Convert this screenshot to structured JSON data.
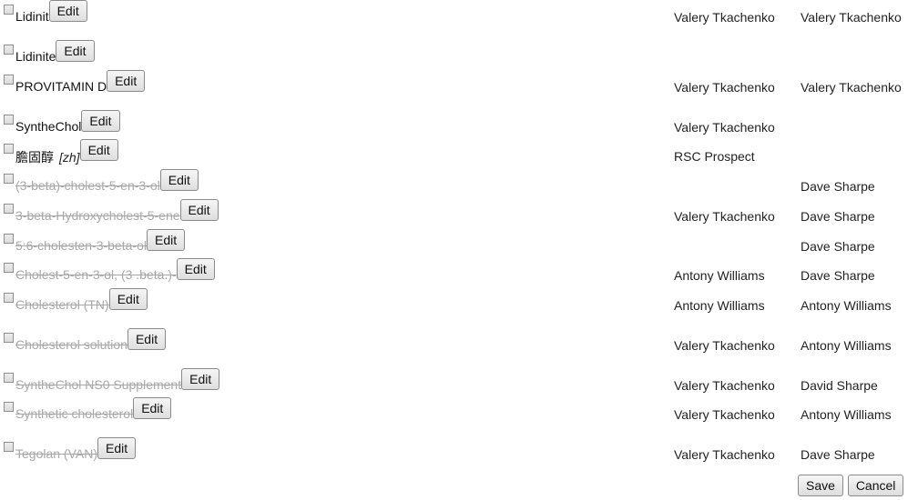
{
  "rows": [
    {
      "name": "Lidinit",
      "deleted": false,
      "lang": "",
      "curator": "Valery Tkachenko",
      "approver": "Valery Tkachenko",
      "edit_label": "Edit"
    },
    {
      "name": "Lidinite",
      "deleted": false,
      "lang": "",
      "curator": "",
      "approver": "",
      "edit_label": "Edit"
    },
    {
      "name": "PROVITAMIN D",
      "deleted": false,
      "lang": "",
      "curator": "Valery Tkachenko",
      "approver": "Valery Tkachenko",
      "edit_label": "Edit"
    },
    {
      "name": "SyntheChol",
      "deleted": false,
      "lang": "",
      "curator": "Valery Tkachenko",
      "approver": "",
      "edit_label": "Edit"
    },
    {
      "name": "膽固醇",
      "deleted": false,
      "lang": "[zh]",
      "curator": "RSC Prospect",
      "approver": "",
      "edit_label": "Edit"
    },
    {
      "name": "(3-beta)-cholest-5-en-3-ol",
      "deleted": true,
      "lang": "",
      "curator": "",
      "approver": "Dave Sharpe",
      "edit_label": "Edit"
    },
    {
      "name": "3-beta-Hydroxycholest-5-ene",
      "deleted": true,
      "lang": "",
      "curator": "Valery Tkachenko",
      "approver": "Dave Sharpe",
      "edit_label": "Edit"
    },
    {
      "name": "5:6-cholesten-3-beta-ol",
      "deleted": true,
      "lang": "",
      "curator": "",
      "approver": "Dave Sharpe",
      "edit_label": "Edit"
    },
    {
      "name": "Cholest-5-en-3-ol, (3 .beta.)-",
      "deleted": true,
      "lang": "",
      "curator": "Antony Williams",
      "approver": "Dave Sharpe",
      "edit_label": "Edit"
    },
    {
      "name": "Cholesterol (TN)",
      "deleted": true,
      "lang": "",
      "curator": "Antony Williams",
      "approver": "Antony Williams",
      "edit_label": "Edit"
    },
    {
      "name": "Cholesterol solution",
      "deleted": true,
      "lang": "",
      "curator": "Valery Tkachenko",
      "approver": "Antony Williams",
      "edit_label": "Edit"
    },
    {
      "name": "SyntheChol NS0 Supplement",
      "deleted": true,
      "lang": "",
      "curator": "Valery Tkachenko",
      "approver": "David Sharpe",
      "edit_label": "Edit"
    },
    {
      "name": "Synthetic cholesterol",
      "deleted": true,
      "lang": "",
      "curator": "Valery Tkachenko",
      "approver": "Antony Williams",
      "edit_label": "Edit"
    },
    {
      "name": "Tegolan (VAN)",
      "deleted": true,
      "lang": "",
      "curator": "Valery Tkachenko",
      "approver": "Dave Sharpe",
      "edit_label": "Edit"
    }
  ],
  "footer": {
    "save_label": "Save",
    "cancel_label": "Cancel"
  }
}
